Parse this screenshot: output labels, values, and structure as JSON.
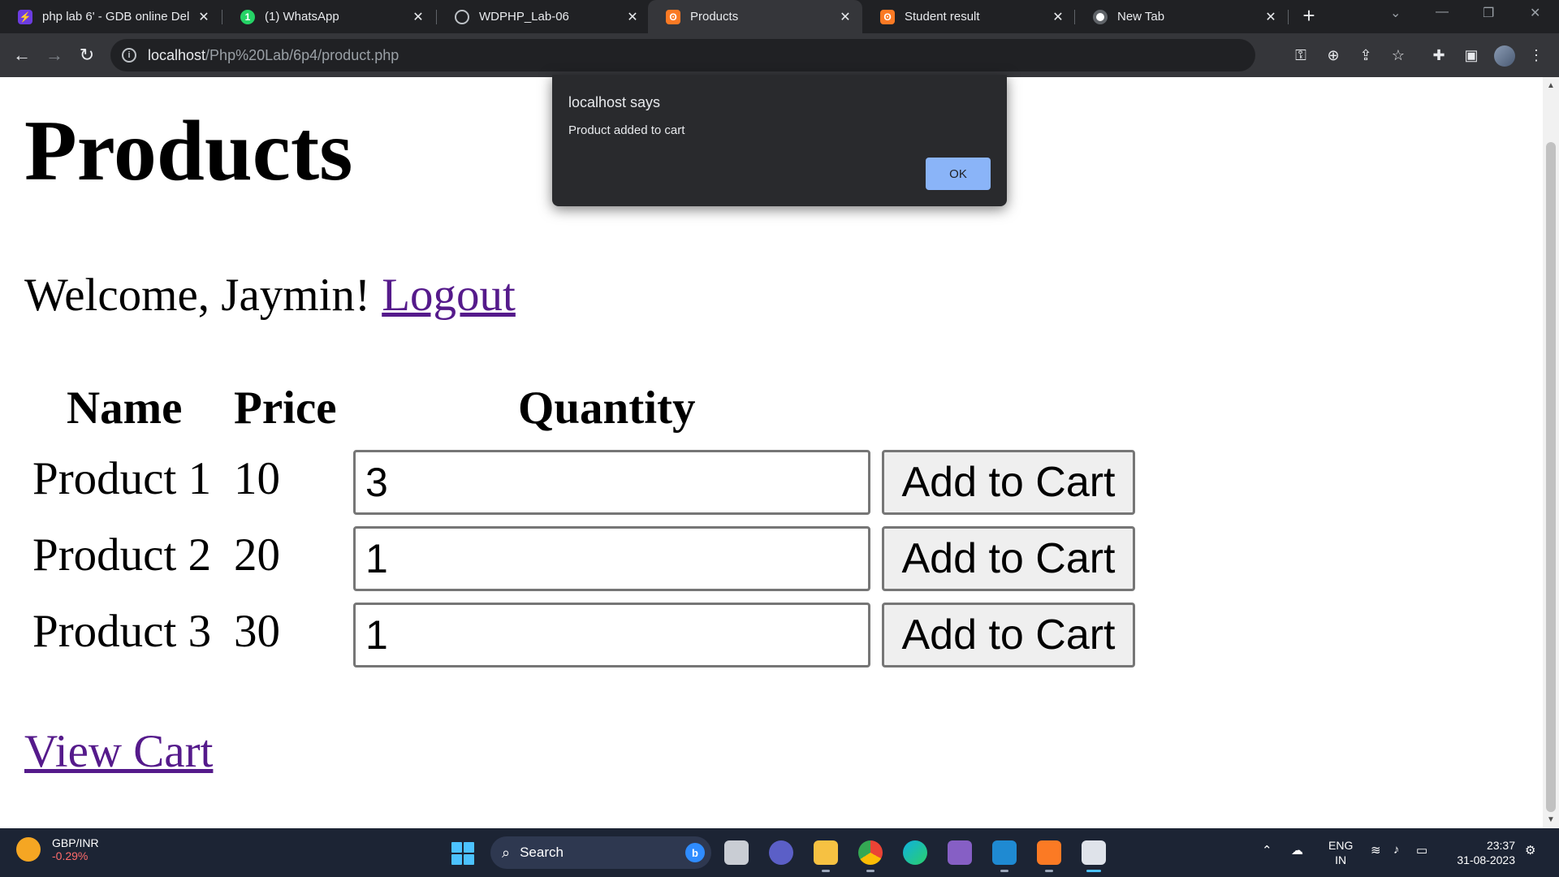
{
  "browser": {
    "tabs": [
      {
        "title": "php lab 6' - GDB online Del",
        "icon": "gdb-icon",
        "active": false
      },
      {
        "title": "(1) WhatsApp",
        "icon": "whatsapp-icon",
        "active": false
      },
      {
        "title": "WDPHP_Lab-06",
        "icon": "globe-icon",
        "active": false
      },
      {
        "title": "Products",
        "icon": "xampp-icon",
        "active": true
      },
      {
        "title": "Student result",
        "icon": "xampp-icon",
        "active": false
      },
      {
        "title": "New Tab",
        "icon": "chrome-icon",
        "active": false
      }
    ],
    "url_host": "localhost",
    "url_path": "/Php%20Lab/6p4/product.php"
  },
  "page": {
    "heading": "Products",
    "welcome_text": "Welcome, Jaymin!",
    "logout_label": "Logout",
    "columns": [
      "Name",
      "Price",
      "Quantity"
    ],
    "products": [
      {
        "name": "Product 1",
        "price": "10",
        "quantity": "3",
        "button": "Add to Cart"
      },
      {
        "name": "Product 2",
        "price": "20",
        "quantity": "1",
        "button": "Add to Cart"
      },
      {
        "name": "Product 3",
        "price": "30",
        "quantity": "1",
        "button": "Add to Cart"
      }
    ],
    "view_cart_label": "View Cart"
  },
  "dialog": {
    "title": "localhost says",
    "message": "Product added to cart",
    "ok_label": "OK"
  },
  "taskbar": {
    "ticker_name": "GBP/INR",
    "ticker_change": "-0.29%",
    "search_label": "Search",
    "lang_line1": "ENG",
    "lang_line2": "IN",
    "time": "23:37",
    "date": "31-08-2023"
  }
}
